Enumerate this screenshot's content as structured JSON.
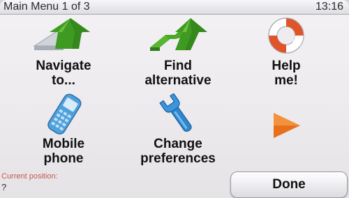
{
  "titlebar": {
    "title": "Main Menu 1 of 3",
    "time": "13:16"
  },
  "tiles": [
    {
      "label_line1": "Navigate",
      "label_line2": "to...",
      "icon": "navigate-arrow-icon"
    },
    {
      "label_line1": "Find",
      "label_line2": "alternative",
      "icon": "alternative-route-icon"
    },
    {
      "label_line1": "Help",
      "label_line2": "me!",
      "icon": "lifebuoy-icon"
    },
    {
      "label_line1": "Mobile",
      "label_line2": "phone",
      "icon": "mobile-phone-icon"
    },
    {
      "label_line1": "Change",
      "label_line2": "preferences",
      "icon": "wrench-icon"
    },
    {
      "icon": "next-page-arrow-icon"
    }
  ],
  "footer": {
    "current_position_label": "Current position:",
    "current_position_value": "?",
    "done_label": "Done"
  },
  "colors": {
    "green_arrow": "#3f9a22",
    "lifebuoy_red": "#e0542a",
    "phone_blue": "#4ea0dc",
    "next_arrow_orange": "#e8701c",
    "position_label_red": "#c4574e"
  }
}
